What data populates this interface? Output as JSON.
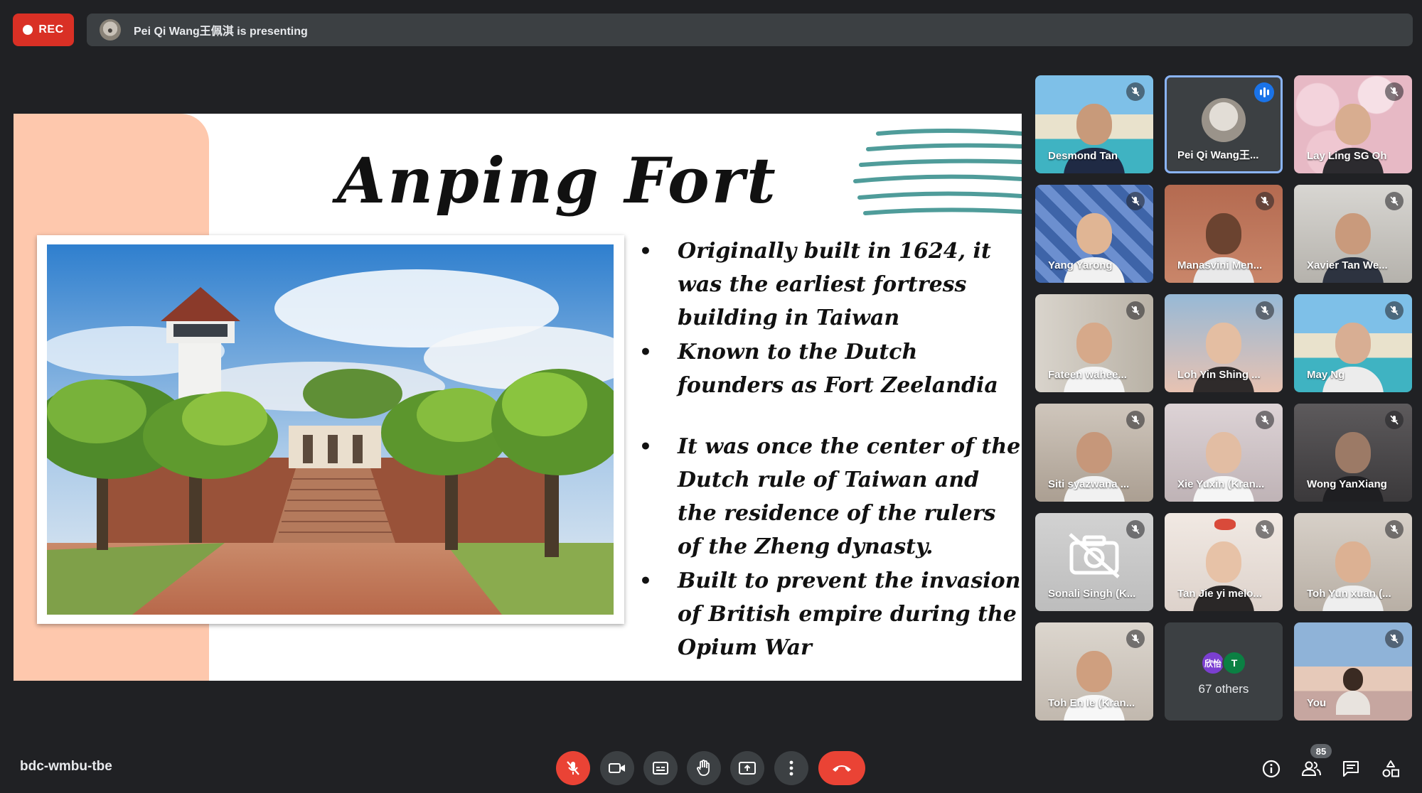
{
  "top_bar": {
    "rec_label": "REC",
    "presenting_text": "Pei Qi Wang王佩淇 is presenting"
  },
  "slide": {
    "title": "Anping Fort",
    "bullets": [
      "Originally built in 1624, it was the earliest fortress building in Taiwan",
      "Known to the Dutch founders as Fort Zeelandia",
      "It was once the center of the Dutch rule of Taiwan and the residence of the rulers of the Zheng dynasty.",
      "Built to prevent the invasion of British empire during the Opium War"
    ]
  },
  "participants": [
    {
      "name": "Desmond Tan",
      "muted": true
    },
    {
      "name": "Pei Qi Wang王...",
      "speaking": true
    },
    {
      "name": "Lay Ling SG Oh",
      "muted": true
    },
    {
      "name": "Yang Yarong",
      "muted": true
    },
    {
      "name": "Manasvini Men...",
      "muted": true
    },
    {
      "name": "Xavier Tan We...",
      "muted": true
    },
    {
      "name": "Fateen wahee...",
      "muted": true
    },
    {
      "name": "Loh Yin Shing ...",
      "muted": true
    },
    {
      "name": "May Ng",
      "muted": true
    },
    {
      "name": "Siti syazwana ...",
      "muted": true
    },
    {
      "name": "Xie Yuxin (Kran...",
      "muted": true
    },
    {
      "name": "Wong YanXiang",
      "muted": true
    },
    {
      "name": "Sonali Singh (K...",
      "muted": true,
      "camera_off": true
    },
    {
      "name": "Tan Jie yi melo...",
      "muted": true
    },
    {
      "name": "Toh Yun xuan (...",
      "muted": true
    },
    {
      "name": "Toh En Ie (Kran...",
      "muted": true
    },
    {
      "name": "You",
      "muted": true
    }
  ],
  "others_tile": {
    "avatar_1": "欣怡",
    "avatar_2": "T",
    "label": "67 others"
  },
  "bottom_bar": {
    "meeting_code": "bdc-wmbu-tbe",
    "participant_count": "85"
  },
  "colors": {
    "background": "#202124",
    "rec_red": "#d93025",
    "hangup_red": "#ea4335",
    "active_speaker_blue": "#1a73e8",
    "slide_peach": "#fec8ad",
    "slide_teal": "#4f9c9a"
  },
  "icons": {
    "mic_off": "mic-off-icon",
    "camera": "camera-icon",
    "captions": "captions-icon",
    "raise_hand": "raise-hand-icon",
    "present": "present-screen-icon",
    "more": "more-options-icon",
    "hangup": "hangup-icon",
    "info": "info-icon",
    "people": "people-icon",
    "chat": "chat-icon",
    "activities": "activities-icon"
  }
}
